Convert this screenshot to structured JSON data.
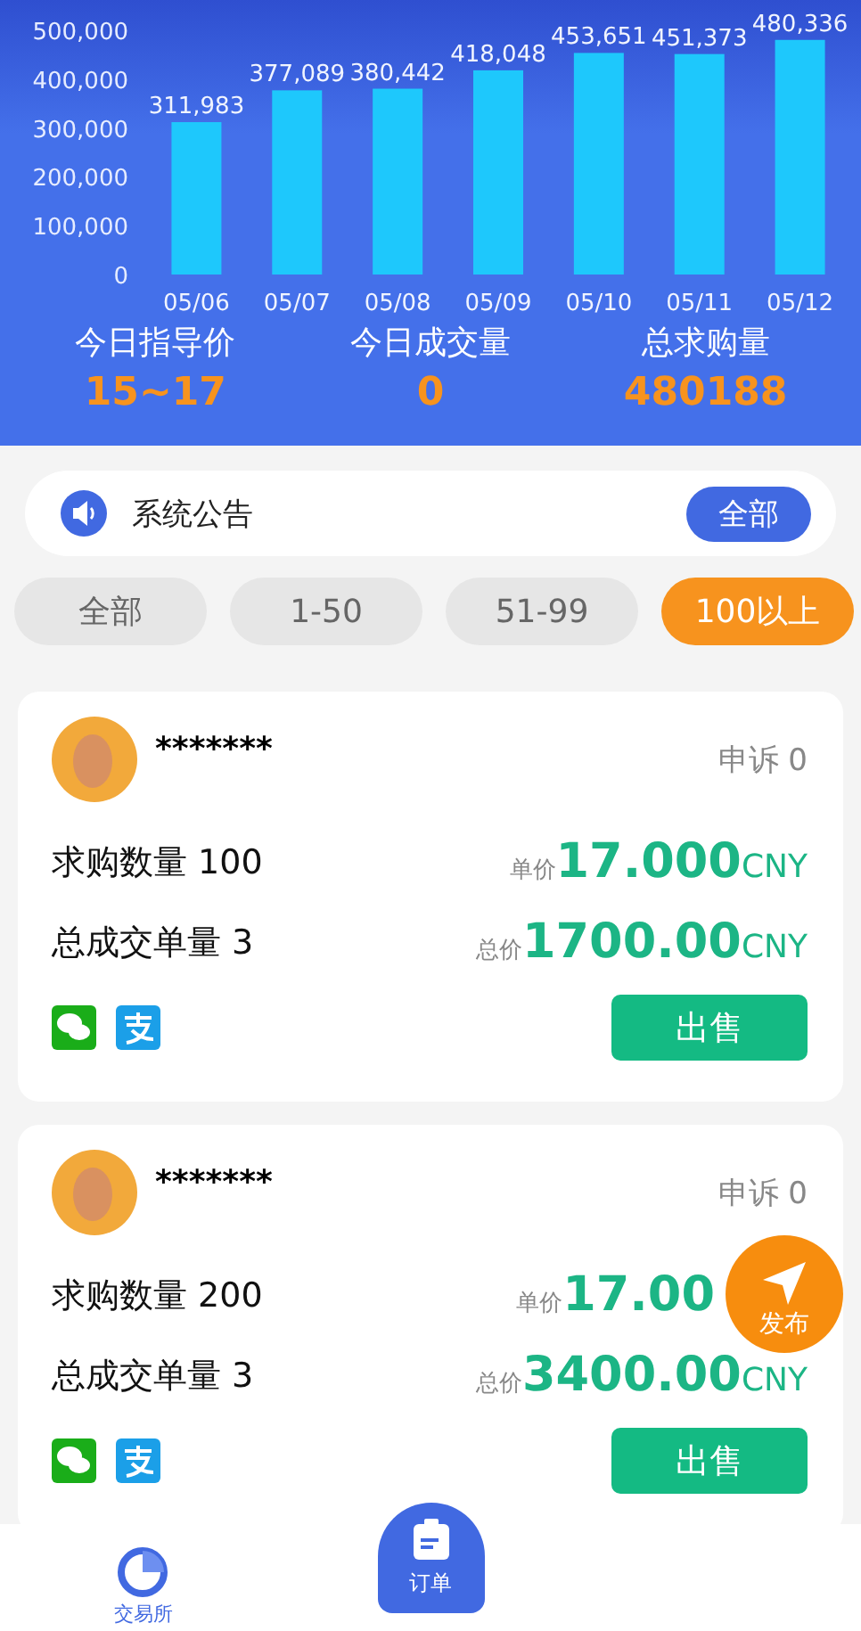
{
  "chart_data": {
    "type": "bar",
    "categories": [
      "05/06",
      "05/07",
      "05/08",
      "05/09",
      "05/10",
      "05/11",
      "05/12"
    ],
    "series": [
      {
        "color": "#1ec8fc",
        "values": [
          311983,
          377089,
          380442,
          418048,
          453651,
          451373,
          480336
        ]
      }
    ],
    "ylim": [
      0,
      500000
    ],
    "yticks": [
      {
        "value": 0,
        "label": "0"
      },
      {
        "value": 100000,
        "label": "100,000"
      },
      {
        "value": 200000,
        "label": "200,000"
      },
      {
        "value": 300000,
        "label": "300,000"
      },
      {
        "value": 400000,
        "label": "400,000"
      },
      {
        "value": 500000,
        "label": "500,000"
      }
    ],
    "value_labels": [
      "311,983",
      "377,089",
      "380,442",
      "418,048",
      "453,651",
      "451,373",
      "480,336"
    ]
  },
  "stats": [
    {
      "label": "今日指导价",
      "value": "15~17"
    },
    {
      "label": "今日成交量",
      "value": "0"
    },
    {
      "label": "总求购量",
      "value": "480188"
    }
  ],
  "notice": {
    "text": "系统公告",
    "button": "全部"
  },
  "filters": [
    {
      "label": "全部",
      "selected": false
    },
    {
      "label": "1-50",
      "selected": false
    },
    {
      "label": "51-99",
      "selected": false
    },
    {
      "label": "100以上",
      "selected": true
    }
  ],
  "orders": [
    {
      "name": "*******",
      "appeal": "申诉 0",
      "quantity": "求购数量 100",
      "deals": "总成交单量 3",
      "unit_label": "单价",
      "unit_price": "17.000",
      "unit_currency": "CNY",
      "total_label": "总价",
      "total_price": "1700.00",
      "total_currency": "CNY",
      "action": "出售"
    },
    {
      "name": "*******",
      "appeal": "申诉 0",
      "quantity": "求购数量 200",
      "deals": "总成交单量 3",
      "unit_label": "单价",
      "unit_price": "17.00",
      "total_label": "总价",
      "total_price": "3400.00",
      "total_currency": "CNY",
      "action": "出售"
    }
  ],
  "publish": "发布",
  "nav": [
    {
      "kind": "exchange",
      "label": "交易所",
      "selected": true
    },
    {
      "kind": "orders",
      "label": "订单",
      "selected": false
    }
  ]
}
